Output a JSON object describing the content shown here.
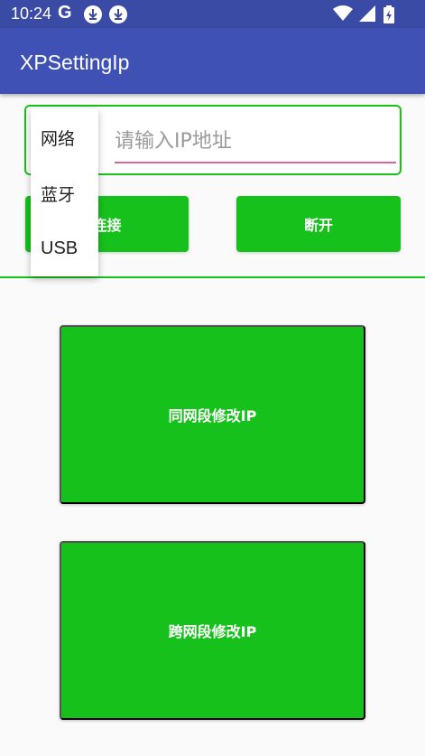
{
  "status_bar": {
    "time": "10:24",
    "g_label": "G",
    "icons": [
      "download-icon",
      "download-icon",
      "wifi-icon",
      "signal-icon",
      "battery-charging-icon"
    ]
  },
  "app_bar": {
    "title": "XPSettingIp"
  },
  "ip_input": {
    "placeholder": "请输入IP地址",
    "value": ""
  },
  "dropdown": {
    "items": [
      "网络",
      "蓝牙",
      "USB"
    ]
  },
  "buttons": {
    "connect": "连接",
    "disconnect": "断开",
    "same_segment": "同网段修改IP",
    "cross_segment": "跨网段修改IP"
  },
  "colors": {
    "status_bar": "#3a4ba5",
    "app_bar": "#3f51b5",
    "button_green": "#17c11c",
    "accent_underline": "#d8679a"
  }
}
